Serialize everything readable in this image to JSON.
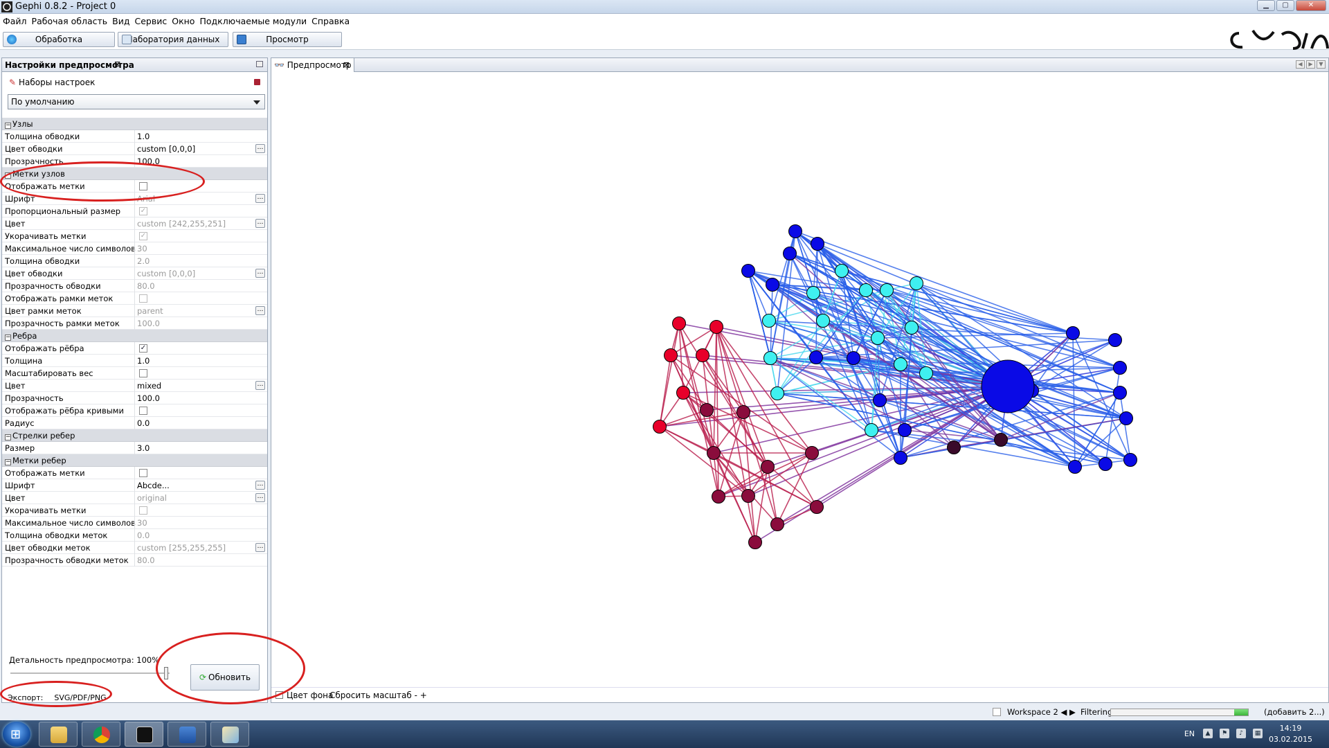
{
  "window": {
    "title": "Gephi 0.8.2 - Project 0"
  },
  "menu": [
    "Файл",
    "Рабочая область",
    "Вид",
    "Сервис",
    "Окно",
    "Подключаемые модули",
    "Справка"
  ],
  "toolbar": {
    "overview": "Обработка",
    "data_lab": "Лаборатория данных",
    "preview": "Просмотр"
  },
  "settings_panel": {
    "title": "Настройки предпросмотра",
    "presets_label": "Наборы настроек",
    "preset_value": "По умолчанию",
    "sections": [
      {
        "name": "Узлы",
        "rows": [
          {
            "label": "Толщина обводки",
            "value": "1.0"
          },
          {
            "label": "Цвет обводки",
            "value": "custom [0,0,0]",
            "dots": true
          },
          {
            "label": "Прозрачность",
            "value": "100.0"
          }
        ]
      },
      {
        "name": "Метки узлов",
        "rows": [
          {
            "label": "Отображать метки",
            "check": false
          },
          {
            "label": "Шрифт",
            "value": "Arial",
            "dots": true,
            "disabled": true
          },
          {
            "label": "Пропорциональный размер",
            "check": true,
            "disabled": true
          },
          {
            "label": "Цвет",
            "value": "custom [242,255,251]",
            "dots": true,
            "disabled": true
          },
          {
            "label": "Укорачивать метки",
            "check": true,
            "disabled": true
          },
          {
            "label": "Максимальное число символов",
            "value": "30",
            "disabled": true
          },
          {
            "label": "Толщина обводки",
            "value": "2.0",
            "disabled": true
          },
          {
            "label": "Цвет обводки",
            "value": "custom [0,0,0]",
            "dots": true,
            "disabled": true
          },
          {
            "label": "Прозрачность обводки",
            "value": "80.0",
            "disabled": true
          },
          {
            "label": "Отображать рамки меток",
            "check": false,
            "disabled": true
          },
          {
            "label": "Цвет рамки меток",
            "value": "parent",
            "dots": true,
            "disabled": true
          },
          {
            "label": "Прозрачность рамки меток",
            "value": "100.0",
            "disabled": true
          }
        ]
      },
      {
        "name": "Ребра",
        "rows": [
          {
            "label": "Отображать рёбра",
            "check": true
          },
          {
            "label": "Толщина",
            "value": "1.0"
          },
          {
            "label": "Масштабировать вес",
            "check": false
          },
          {
            "label": "Цвет",
            "value": "mixed",
            "dots": true
          },
          {
            "label": "Прозрачность",
            "value": "100.0"
          },
          {
            "label": "Отображать рёбра кривыми",
            "check": false
          },
          {
            "label": "Радиус",
            "value": "0.0"
          }
        ]
      },
      {
        "name": "Стрелки ребер",
        "rows": [
          {
            "label": "Размер",
            "value": "3.0"
          }
        ]
      },
      {
        "name": "Метки ребер",
        "rows": [
          {
            "label": "Отображать метки",
            "check": false
          },
          {
            "label": "Шрифт",
            "value": "Abcde...",
            "dots": true
          },
          {
            "label": "Цвет",
            "value": "original",
            "dots": true,
            "disabled": true
          },
          {
            "label": "Укорачивать метки",
            "check": false,
            "disabled": true
          },
          {
            "label": "Максимальное число символов",
            "value": "30",
            "disabled": true
          },
          {
            "label": "Толщина обводки меток",
            "value": "0.0",
            "disabled": true
          },
          {
            "label": "Цвет обводки меток",
            "value": "custom [255,255,255]",
            "dots": true,
            "disabled": true
          },
          {
            "label": "Прозрачность обводки меток",
            "value": "80.0",
            "disabled": true
          }
        ]
      }
    ],
    "detail_label": "Детальность предпросмотра: 100%",
    "detail_level": 1.0,
    "refresh": "Обновить",
    "export_label": "Экспорт:",
    "export_formats": "SVG/PDF/PNG"
  },
  "preview_panel": {
    "tab": "Предпросмотр",
    "bg_color_label": "Цвет фона",
    "reset_zoom": "Сбросить масштаб",
    "zoom_out": "-",
    "zoom_in": "+"
  },
  "status": {
    "workspace": "Workspace 2",
    "filtering": "Filtering",
    "add": "(добавить 2...)"
  },
  "taskbar": {
    "lang": "EN",
    "time": "14:19",
    "date": "03.02.2015"
  },
  "colors": {
    "red": "#e8002a",
    "dark_red": "#8a0c3c",
    "blue": "#0a0ae6",
    "cyan": "#3ff0f0",
    "annotation": "#d8201f"
  }
}
